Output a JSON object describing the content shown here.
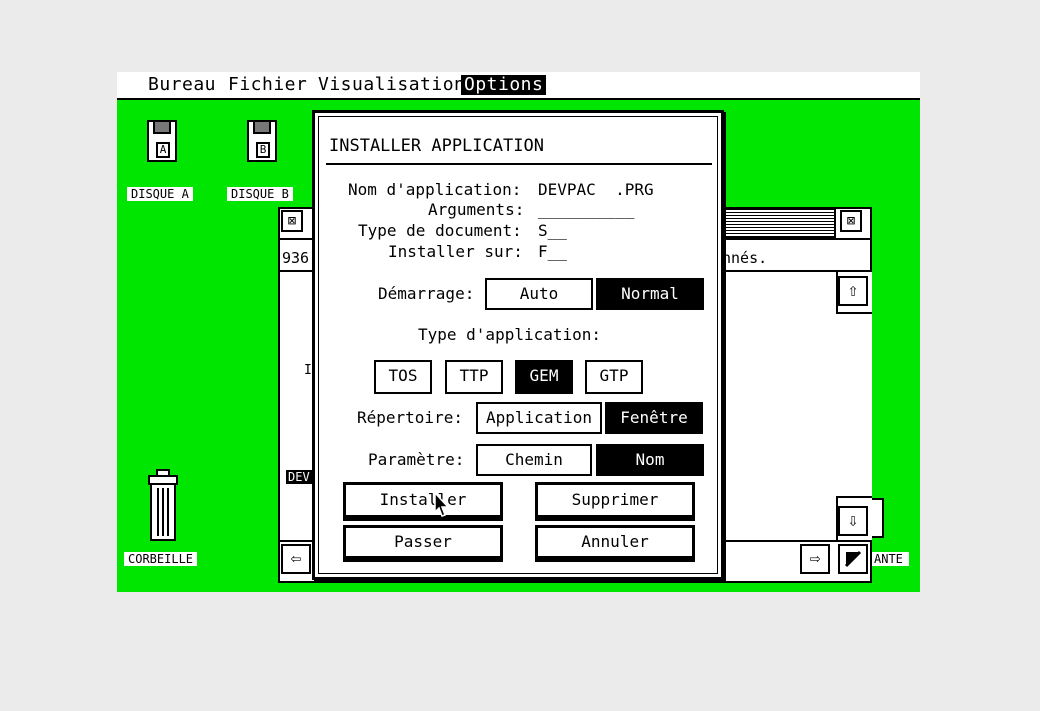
{
  "menu": {
    "items": [
      "Bureau",
      "Fichier",
      "Visualisation",
      "Options"
    ],
    "active": "Options"
  },
  "desktop": {
    "icons": {
      "disk_a_letter": "A",
      "disk_a_label": "DISQUE A",
      "disk_b_letter": "B",
      "disk_b_label": "DISQUE B",
      "trash_label": "CORBEILLE",
      "printer_label_fragment": "ANTE"
    }
  },
  "background_window": {
    "close_glyph": "⊠",
    "info_left": "936",
    "info_right": "nnés.",
    "item_label_fragment": "DEV",
    "item_letter_fragment": "I",
    "scroll_up": "⇧",
    "scroll_down": "⇩",
    "scroll_left": "⇦",
    "scroll_right": "⇨"
  },
  "dialog": {
    "title": "INSTALLER APPLICATION",
    "fields": {
      "app_name_label": "Nom d'application:",
      "app_name_value": "DEVPAC  .PRG",
      "args_label": "Arguments:",
      "args_value": "__________",
      "doc_type_label": "Type de document:",
      "doc_type_value": "S__",
      "install_on_label": "Installer sur:",
      "install_on_value": "F__"
    },
    "startup": {
      "label": "Démarrage:",
      "options": [
        "Auto",
        "Normal"
      ],
      "selected": "Normal"
    },
    "app_type": {
      "label": "Type d'application:",
      "options": [
        "TOS",
        "TTP",
        "GEM",
        "GTP"
      ],
      "selected": "GEM"
    },
    "directory": {
      "label": "Répertoire:",
      "options": [
        "Application",
        "Fenêtre"
      ],
      "selected": "Fenêtre"
    },
    "parameter": {
      "label": "Paramètre:",
      "options": [
        "Chemin",
        "Nom"
      ],
      "selected": "Nom"
    },
    "buttons": {
      "install": "Installer",
      "remove": "Supprimer",
      "skip": "Passer",
      "cancel": "Annuler"
    }
  },
  "colors": {
    "desktop": "#00e600",
    "outer_bg": "#ebebeb"
  }
}
